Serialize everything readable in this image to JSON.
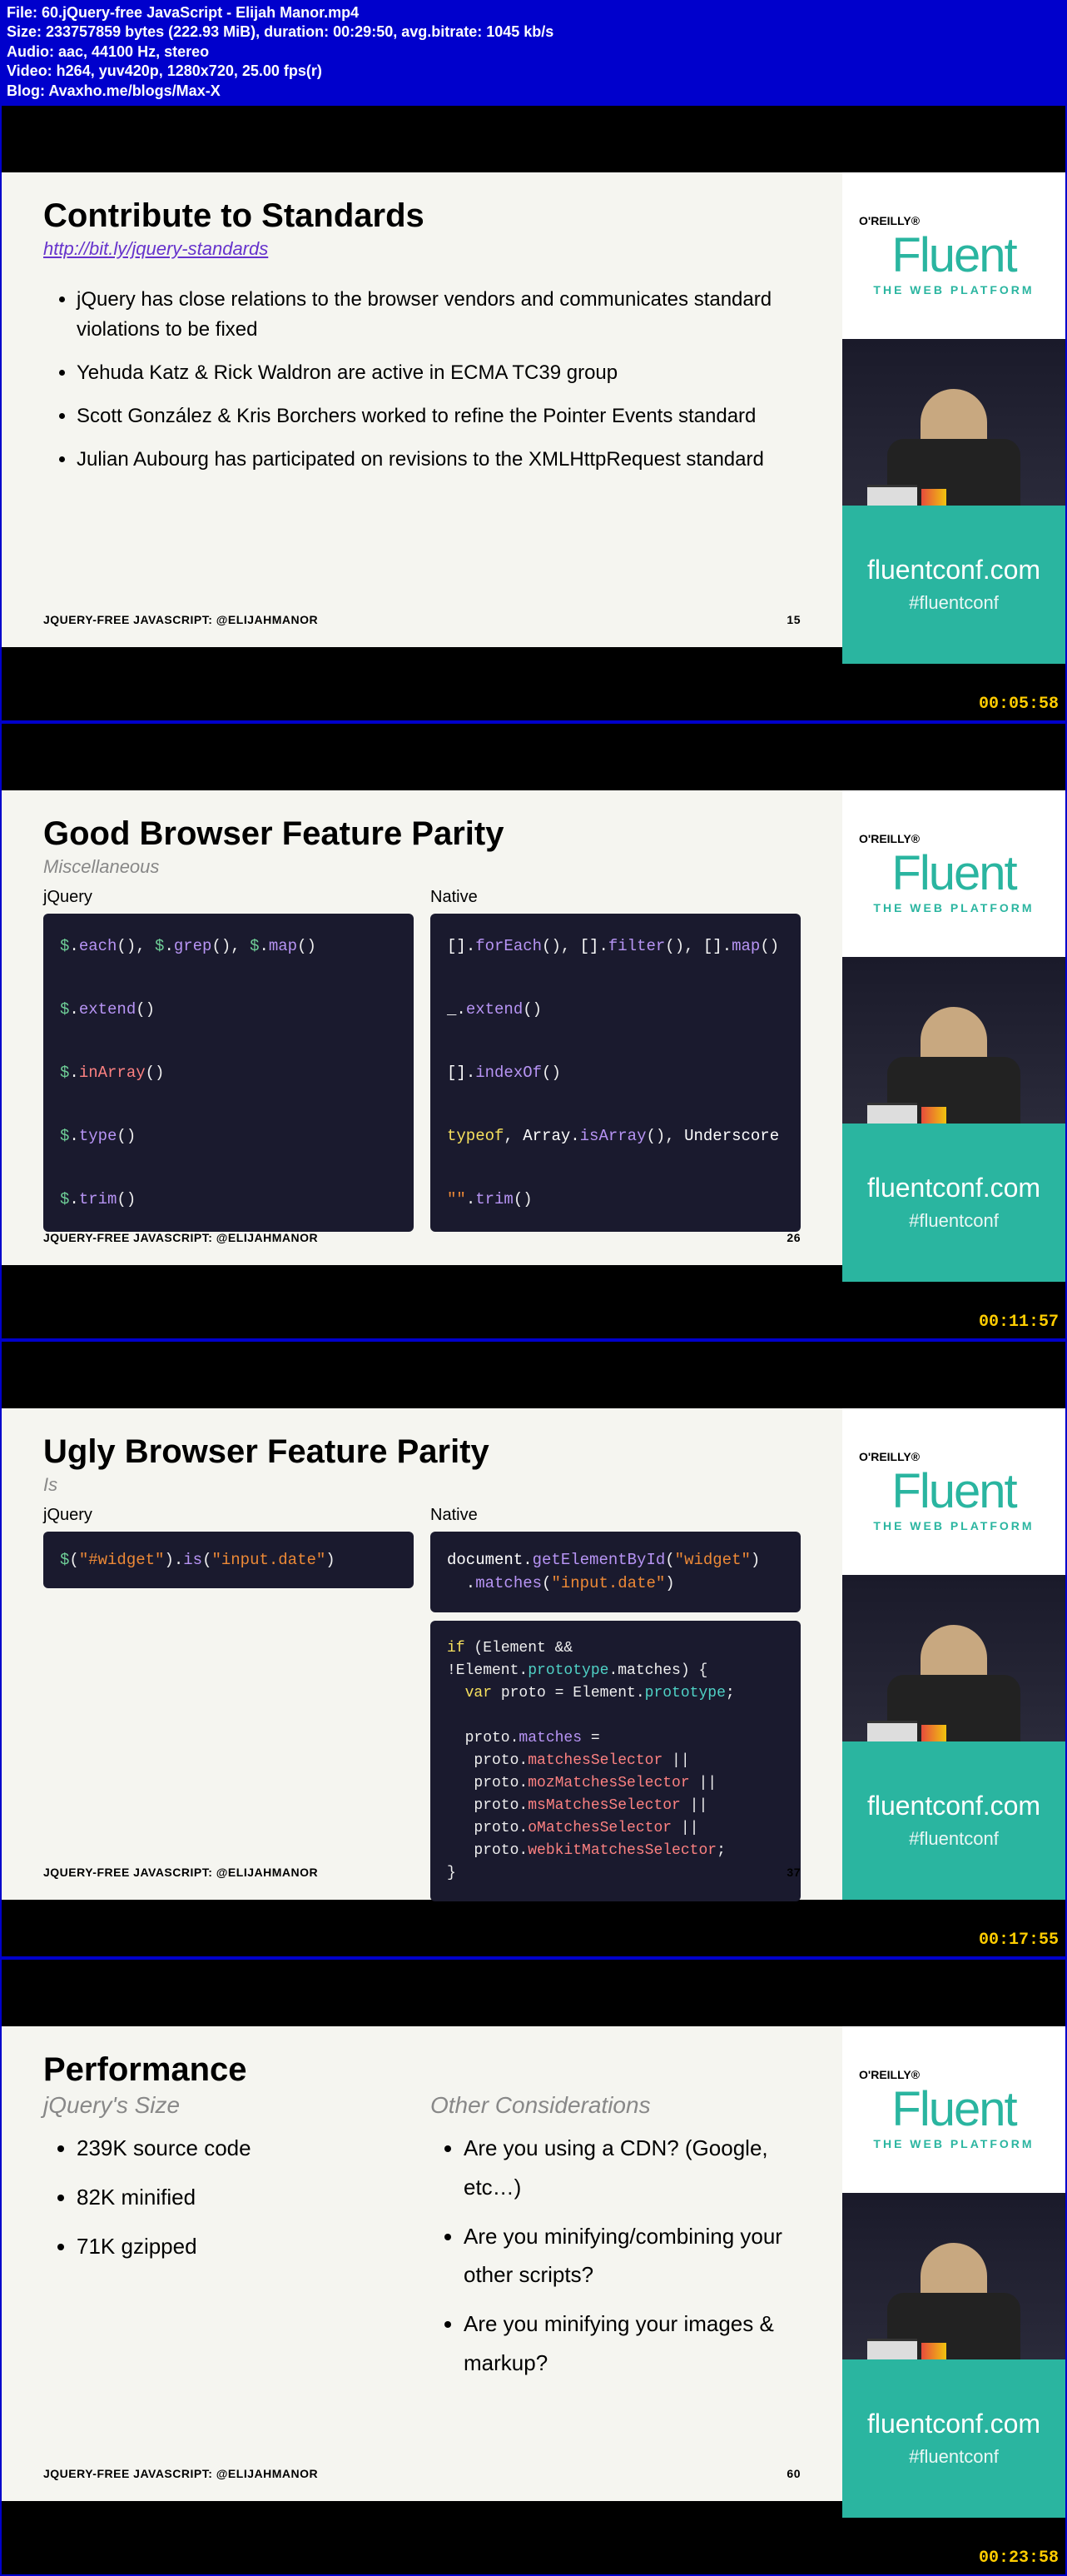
{
  "header": {
    "l1": "File: 60.jQuery-free JavaScript - Elijah Manor.mp4",
    "l2": "Size: 233757859 bytes (222.93 MiB), duration: 00:29:50, avg.bitrate: 1045 kb/s",
    "l3": "Audio: aac, 44100 Hz, stereo",
    "l4": "Video: h264, yuv420p, 1280x720, 25.00 fps(r)",
    "l5": "Blog: Avaxho.me/blogs/Max-X"
  },
  "logo": {
    "oreilly": "O'REILLY®",
    "name": "Fluent",
    "tag": "THE WEB PLATFORM"
  },
  "banner": {
    "url": "fluentconf.com",
    "hash": "#fluentconf"
  },
  "footer": "JQUERY-FREE JAVASCRIPT: @ELIJAHMANOR",
  "slide1": {
    "title": "Contribute to Standards",
    "link": "http://bit.ly/jquery-standards",
    "b1": "jQuery has close relations to the browser vendors and communicates standard violations to be fixed",
    "b2": "Yehuda Katz & Rick Waldron are active in ECMA TC39 group",
    "b3": "Scott González & Kris Borchers worked to refine the Pointer Events standard",
    "b4": "Julian Aubourg has participated on revisions to the XMLHttpRequest standard",
    "page": "15",
    "ts": "00:05:58"
  },
  "slide2": {
    "title": "Good Browser Feature Parity",
    "sub": "Miscellaneous",
    "jq": "jQuery",
    "nat": "Native",
    "page": "26",
    "ts": "00:11:57"
  },
  "slide3": {
    "title": "Ugly Browser Feature Parity",
    "sub": "Is",
    "jq": "jQuery",
    "nat": "Native",
    "page": "37",
    "ts": "00:17:55"
  },
  "slide4": {
    "title": "Performance",
    "sub1": "jQuery's Size",
    "sub2": "Other Considerations",
    "a1": "239K source code",
    "a2": "82K minified",
    "a3": "71K gzipped",
    "c1": "Are you using a CDN? (Google, etc…)",
    "c2": "Are you minifying/combining your other scripts?",
    "c3": "Are you minifying your images & markup?",
    "page": "60",
    "ts": "00:23:58"
  }
}
